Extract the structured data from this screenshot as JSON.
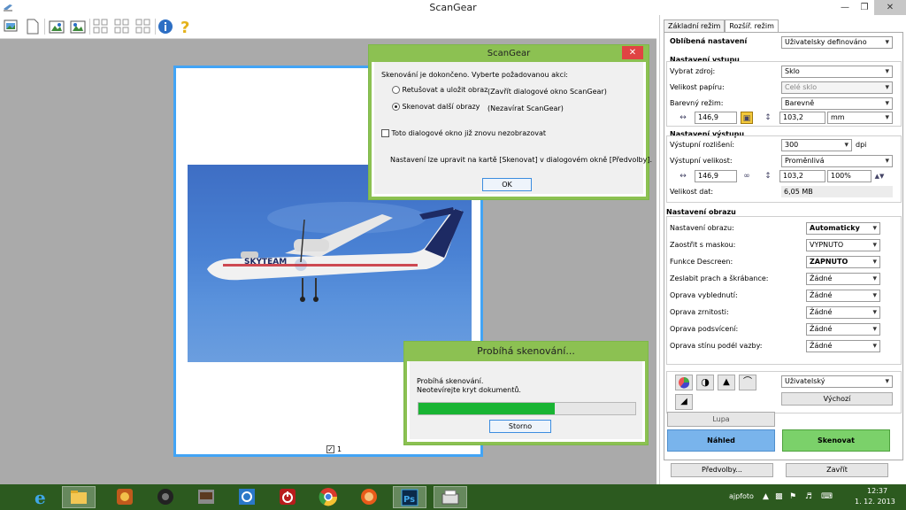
{
  "window": {
    "title": "ScanGear"
  },
  "preview": {
    "thumbnail_index": "1"
  },
  "dialog_scangear": {
    "title": "ScanGear",
    "message": "Skenování je dokončeno. Vyberte požadovanou akci:",
    "option1_label": "Retušovat a uložit obraz",
    "option1_desc": "(Zavřít dialogové okno ScanGear)",
    "option2_label": "Skenovat další obrazy",
    "option2_desc": "(Nezavírat ScanGear)",
    "checkbox_label": "Toto dialogové okno již znovu nezobrazovat",
    "note": "Nastavení lze upravit na kartě [Skenovat] v dialogovém okně [Předvolby].",
    "ok_label": "OK"
  },
  "dialog_progress": {
    "title": "Probíhá skenování...",
    "line1": "Probíhá skenování.",
    "line2": "Neotevírejte kryt dokumentů.",
    "progress": 0.63,
    "cancel_label": "Storno"
  },
  "panel": {
    "tabs": [
      "Základní režim",
      "Rozšíř. režim"
    ],
    "favorite_label": "Oblíbená nastavení",
    "favorite_value": "Uživatelsky definováno",
    "input": {
      "header": "Nastavení vstupu",
      "source_label": "Vybrat zdroj:",
      "source_value": "Sklo",
      "paper_label": "Velikost papíru:",
      "paper_value": "Celé sklo",
      "color_label": "Barevný režim:",
      "color_value": "Barevně",
      "width": "146,9",
      "height": "103,2",
      "unit": "mm"
    },
    "output": {
      "header": "Nastavení výstupu",
      "res_label": "Výstupní rozlišení:",
      "res_value": "300",
      "res_unit": "dpi",
      "size_label": "Výstupní velikost:",
      "size_value": "Proměnlivá",
      "width": "146,9",
      "height": "103,2",
      "scale": "100%",
      "datasize_label": "Velikost dat:",
      "datasize_value": "6,05 MB"
    },
    "image": {
      "header": "Nastavení obrazu",
      "rows": [
        {
          "label": "Nastavení obrazu:",
          "value": "Automaticky",
          "bold": true
        },
        {
          "label": "Zaostřit s maskou:",
          "value": "VYPNUTO",
          "bold": false
        },
        {
          "label": "Funkce Descreen:",
          "value": "ZAPNUTO",
          "bold": true
        },
        {
          "label": "Zeslabit prach a škrábance:",
          "value": "Žádné",
          "bold": false
        },
        {
          "label": "Oprava vyblednutí:",
          "value": "Žádné",
          "bold": false
        },
        {
          "label": "Oprava zrnitosti:",
          "value": "Žádné",
          "bold": false
        },
        {
          "label": "Oprava podsvícení:",
          "value": "Žádné",
          "bold": false
        },
        {
          "label": "Oprava stínu podél vazby:",
          "value": "Žádné",
          "bold": false
        }
      ]
    },
    "tone_value": "Uživatelský",
    "default_label": "Výchozí",
    "zoom_label": "Lupa",
    "preview_label": "Náhled",
    "scan_label": "Skenovat",
    "prefs_label": "Předvolby...",
    "close_label": "Zavřít"
  },
  "taskbar": {
    "user": "ajpfoto",
    "time": "12:37",
    "date": "1. 12. 2013"
  },
  "colors": {
    "accent": "#8cc152",
    "progress": "#19b433",
    "preview_btn": "#79b4ec",
    "scan_btn": "#7bd16a"
  }
}
